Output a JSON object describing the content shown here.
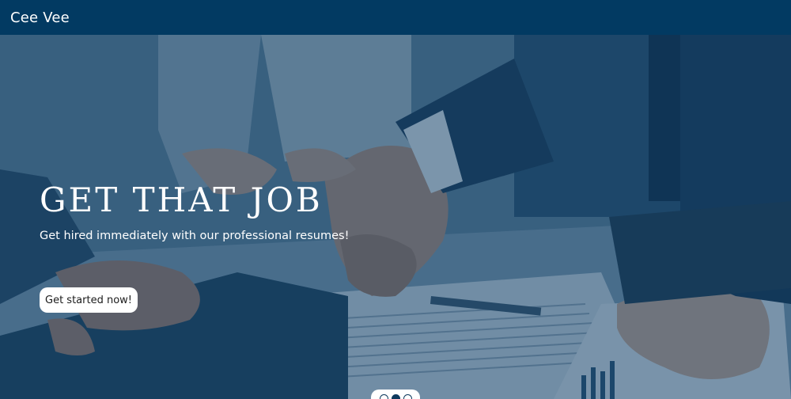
{
  "navbar": {
    "brand": "Cee Vee"
  },
  "hero": {
    "headline": "GET THAT JOB",
    "subline": "Get hired immediately with our professional resumes!",
    "cta_label": "Get started now!",
    "background_image": "handshake-contract-photo",
    "overlay_color": "#08375f"
  },
  "carousel": {
    "slide_count": 3,
    "active_index": 1
  },
  "colors": {
    "navbar_bg": "#023a62",
    "text_on_dark": "#ffffff",
    "button_bg": "#ffffff"
  }
}
